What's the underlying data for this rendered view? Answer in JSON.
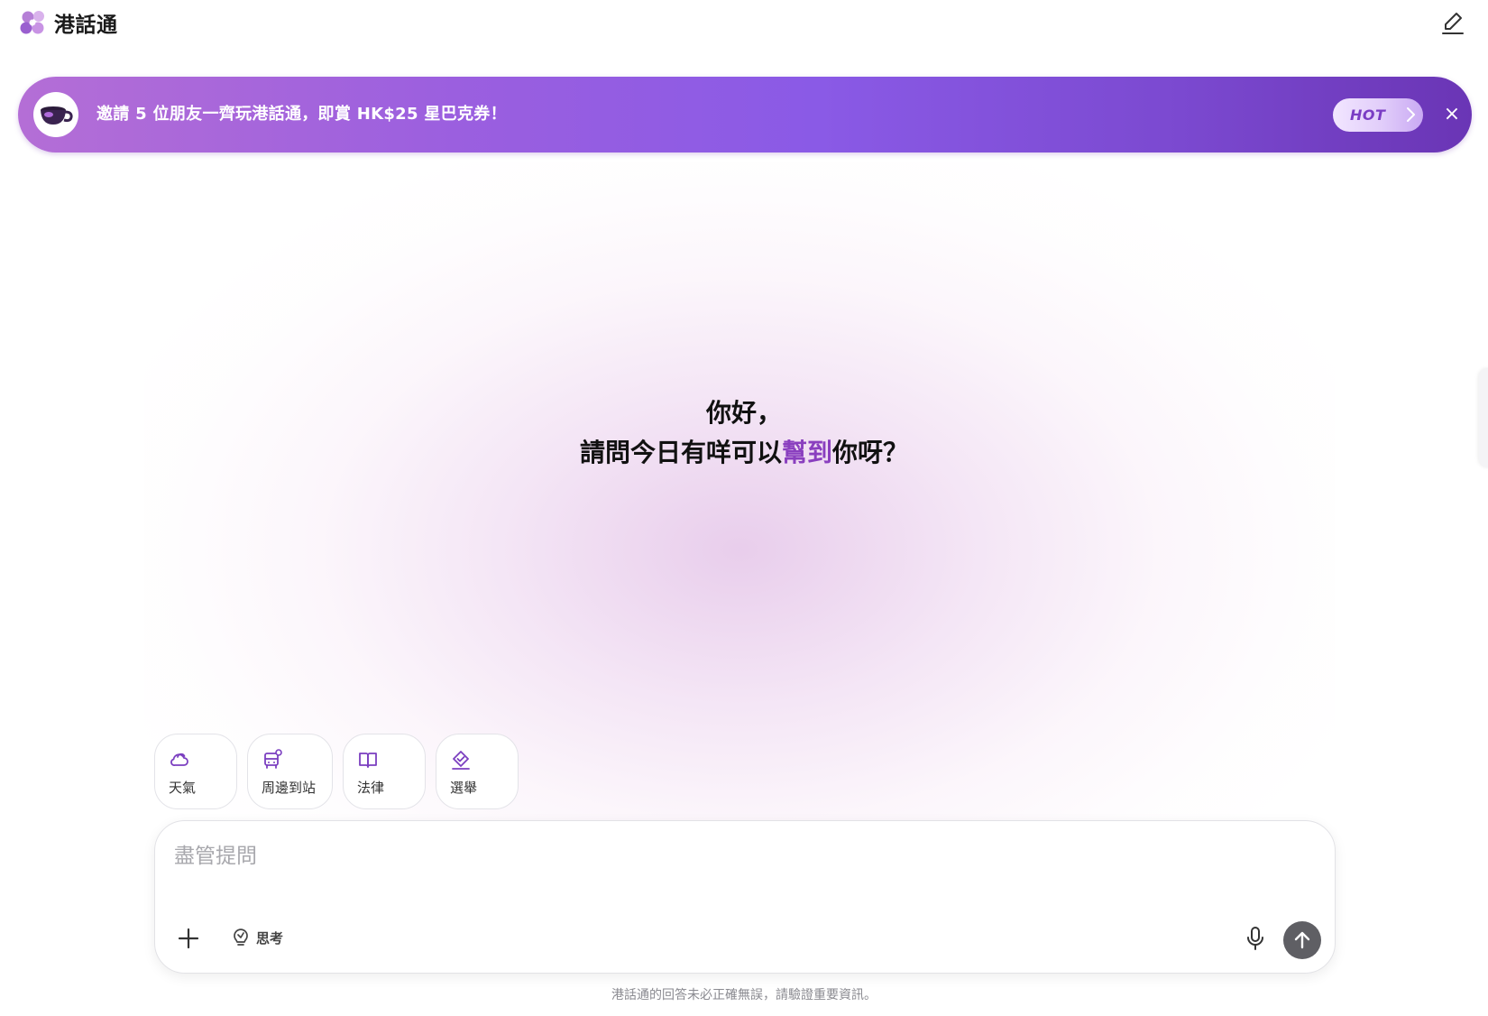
{
  "header": {
    "app_title": "港話通",
    "logo_icon": "flower-logo-icon",
    "edit_icon": "edit-pencil-icon"
  },
  "banner": {
    "text": "邀請 5 位朋友一齊玩港話通，即賞 HK$25 星巴克券！",
    "badge": "HOT",
    "close": "×",
    "icon": "coffee-cup-icon"
  },
  "greeting": {
    "line1": "你好，",
    "line2_before": "請問今日有咩可以",
    "line2_accent": "幫到",
    "line2_after": "你呀？",
    "accent_color": "#8a3fbf"
  },
  "chips": [
    {
      "label": "天氣",
      "icon": "weather-cloud-icon"
    },
    {
      "label": "周邊到站",
      "icon": "bus-icon"
    },
    {
      "label": "法律",
      "icon": "book-icon"
    },
    {
      "label": "選舉",
      "icon": "ballot-check-icon"
    }
  ],
  "composer": {
    "placeholder": "盡管提問",
    "value": "",
    "think_label": "思考"
  },
  "footer": {
    "disclaimer": "港話通的回答未必正確無誤，請驗證重要資訊。"
  },
  "colors": {
    "banner_start": "#b46ed6",
    "banner_end": "#6a35b5",
    "chip_icon": "#7b3fc0",
    "send_button": "#5f5f64"
  }
}
